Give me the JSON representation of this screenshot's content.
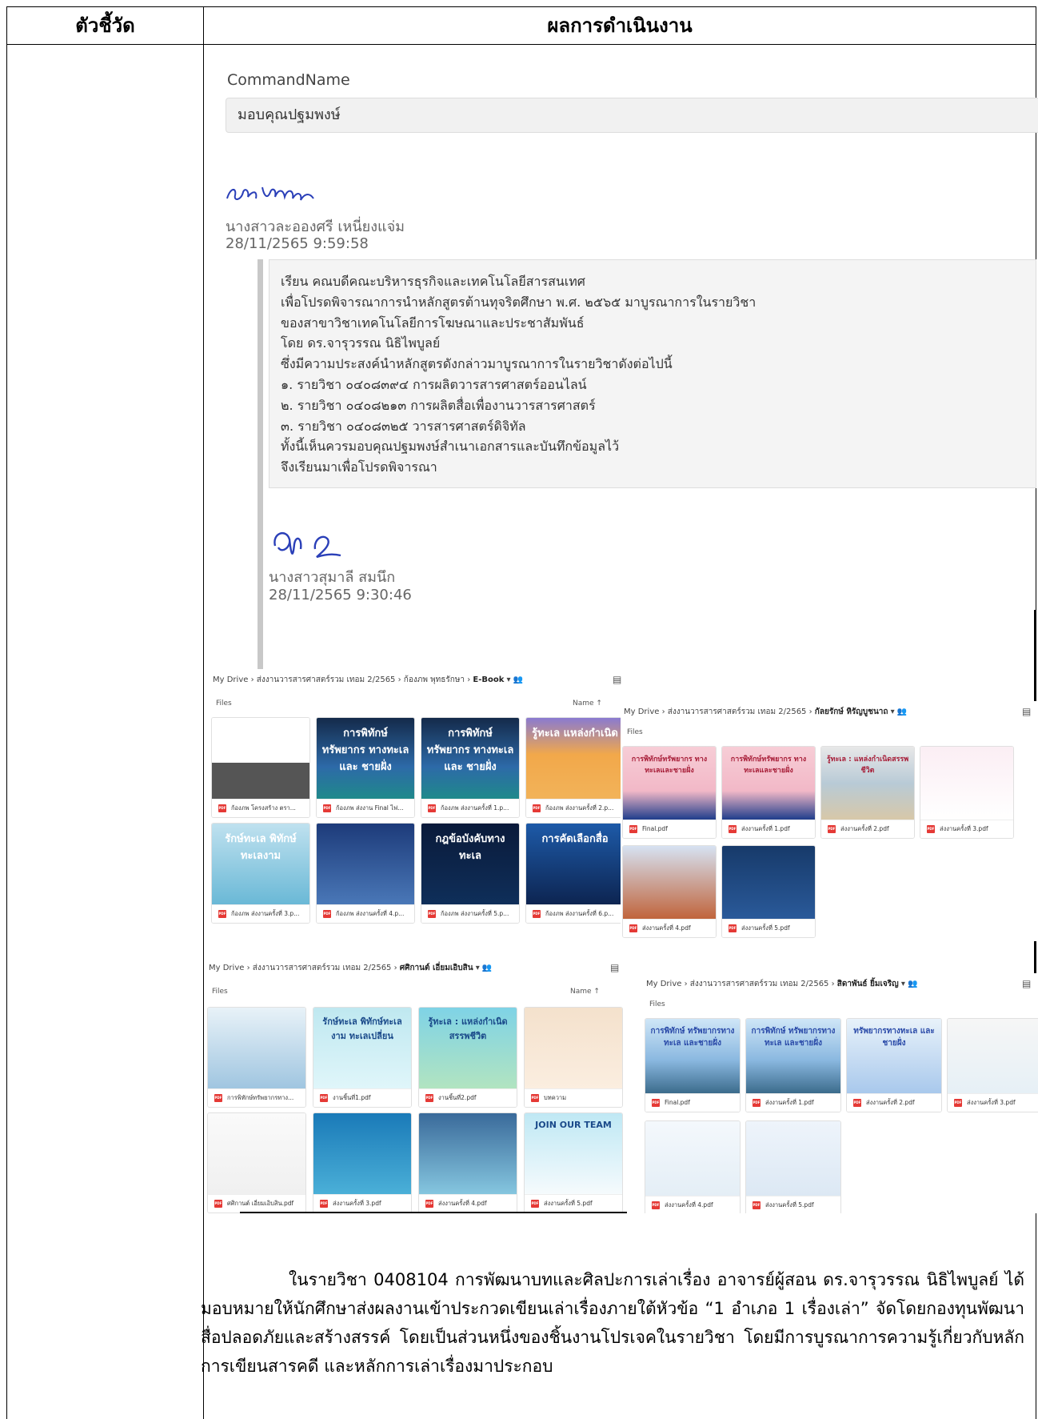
{
  "table": {
    "col1_header": "ตัวชี้วัด",
    "col2_header": "ผลการดำเนินงาน"
  },
  "edoc": {
    "command_label": "CommandName",
    "command_value": "มอบคุณปฐมพงษ์",
    "signer1_name": "นางสาวละอองศรี เหนี่ยงแจ่ม",
    "signer1_date": "28/11/2565 9:59:58",
    "memo_lines": [
      "เรียน คณบดีคณะบริหารธุรกิจและเทคโนโลยีสารสนเทศ",
      "เพื่อโปรดพิจารณาการนำหลักสูตรต้านทุจริตศึกษา พ.ศ. ๒๕๖๕ มาบูรณาการในรายวิชา",
      "ของสาขาวิชาเทคโนโลยีการโฆษณาและประชาสัมพันธ์",
      "โดย ดร.จารุวรรณ นิธิไพบูลย์",
      "ซึ่งมีความประสงค์นำหลักสูตรดังกล่าวมาบูรณาการในรายวิชาดังต่อไปนี้",
      "๑. รายวิชา ๐๔๐๘๓๙๔ การผลิตวารสารศาสตร์ออนไลน์",
      "๒. รายวิชา ๐๔๐๘๒๑๓ การผลิตสื่อเพื่องานวารสารศาสตร์",
      "๓. รายวิชา ๐๔๐๘๓๒๕ วารสารศาสตร์ดิจิทัล",
      "ทั้งนี้เห็นควรมอบคุณปฐมพงษ์สำเนาเอกสารและบันทึกข้อมูลไว้",
      "จึงเรียนมาเพื่อโปรดพิจารณา"
    ],
    "signer2_name": "นางสาวสุมาลี สมนึก",
    "signer2_date": "28/11/2565 9:30:46"
  },
  "drive": {
    "panel1": {
      "root": "My Drive",
      "folder": "ส่งงานวารสารศาสตร์รวม เทอม 2/2565",
      "sub": "ก้องภพ พุทธรักษา",
      "current": "E-Book",
      "files_label": "Files",
      "sort_label": "Name",
      "files": [
        {
          "name": "ก้องภพ โครงสร้าง ตรา...",
          "title": ""
        },
        {
          "name": "ก้องภพ ส่งงาน Final ไฟ...",
          "title": "การพิทักษ์ ทรัพยากร ทางทะเล และ ชายฝั่ง"
        },
        {
          "name": "ก้องภพ ส่งงานครั้งที่ 1.p...",
          "title": "การพิทักษ์ ทรัพยากร ทางทะเล และ ชายฝั่ง"
        },
        {
          "name": "ก้องภพ ส่งงานครั้งที่ 2.p...",
          "title": "รู้ทะเล แหล่งกำเนิด"
        },
        {
          "name": "ก้องภพ ส่งงานครั้งที่ 3.p...",
          "title": "รักษ์ทะเล พิทักษ์ทะเลงาม"
        },
        {
          "name": "ก้องภพ ส่งงานครั้งที่ 4.p...",
          "title": ""
        },
        {
          "name": "ก้องภพ ส่งงานครั้งที่ 5.p...",
          "title": "กฎข้อบังคับทางทะเล"
        },
        {
          "name": "ก้องภพ ส่งงานครั้งที่ 6.p...",
          "title": "การคัดเลือกสื่อ"
        }
      ]
    },
    "panel2": {
      "root": "My Drive",
      "folder": "ส่งงานวารสารศาสตร์รวม เทอม 2/2565",
      "current": "กัลยรักษ์ หิรัญบูชนาถ",
      "files_label": "Files",
      "files": [
        {
          "name": "Final.pdf",
          "title": "การพิทักษ์ทรัพยากร ทางทะเลและชายฝั่ง"
        },
        {
          "name": "ส่งงานครั้งที่ 1.pdf",
          "title": "การพิทักษ์ทรัพยากร ทางทะเลและชายฝั่ง"
        },
        {
          "name": "ส่งงานครั้งที่ 2.pdf",
          "title": "รู้ทะเล : แหล่งกำเนิดสรรพชีวิต"
        },
        {
          "name": "ส่งงานครั้งที่ 3.pdf",
          "title": ""
        },
        {
          "name": "ส่งงานครั้งที่ 4.pdf",
          "title": ""
        },
        {
          "name": "ส่งงานครั้งที่ 5.pdf",
          "title": ""
        }
      ]
    },
    "panel3": {
      "root": "My Drive",
      "folder": "ส่งงานวารสารศาสตร์รวม เทอม 2/2565",
      "current": "ศศิกานต์ เอี่ยมเอิบสิน",
      "files_label": "Files",
      "sort_label": "Name",
      "files": [
        {
          "name": "การพิทักษ์ทรัพยากรทาง...",
          "title": ""
        },
        {
          "name": "งานชิ้นที่1.pdf",
          "title": "รักษ์ทะเล พิทักษ์ทะเลงาม ทะเลเปลี่ยน"
        },
        {
          "name": "งานชิ้นที่2.pdf",
          "title": "รู้ทะเล : แหล่งกำเนิดสรรพชีวิต"
        },
        {
          "name": "บทความ",
          "title": ""
        },
        {
          "name": "ศศิกานต์ เอี่ยมเอิบสิน.pdf",
          "title": ""
        },
        {
          "name": "ส่งงานครั้งที่ 3.pdf",
          "title": ""
        },
        {
          "name": "ส่งงานครั้งที่ 4.pdf",
          "title": ""
        },
        {
          "name": "ส่งงานครั้งที่ 5.pdf",
          "title": "JOIN OUR TEAM"
        }
      ]
    },
    "panel4": {
      "root": "My Drive",
      "folder": "ส่งงานวารสารศาสตร์รวม เทอม 2/2565",
      "current": "สิดาพันธ์ ยิ้มเจริญ",
      "files_label": "Files",
      "files": [
        {
          "name": "Final.pdf",
          "title": "การพิทักษ์ ทรัพยากรทางทะเล และชายฝั่ง"
        },
        {
          "name": "ส่งงานครั้งที่ 1.pdf",
          "title": "การพิทักษ์ ทรัพยากรทางทะเล และชายฝั่ง"
        },
        {
          "name": "ส่งงานครั้งที่ 2.pdf",
          "title": "ทรัพยากรทางทะเล และชายฝั่ง"
        },
        {
          "name": "ส่งงานครั้งที่ 3.pdf",
          "title": ""
        },
        {
          "name": "ส่งงานครั้งที่ 4.pdf",
          "title": ""
        },
        {
          "name": "ส่งงานครั้งที่ 5.pdf",
          "title": ""
        }
      ]
    }
  },
  "body_text": "ในรายวิชา 0408104 การพัฒนาบทและศิลปะการเล่าเรื่อง อาจารย์ผู้สอน ดร.จารุวรรณ นิธิไพบูลย์ ได้มอบหมายให้นักศึกษาส่งผลงานเข้าประกวดเขียนเล่าเรื่องภายใต้หัวข้อ “1 อำเภอ 1 เรื่องเล่า” จัดโดยกองทุนพัฒนาสื่อปลอดภัยและสร้างสรรค์ โดยเป็นส่วนหนึ่งของชิ้นงานโปรเจคในรายวิชา โดยมีการบูรณาการความรู้เกี่ยวกับหลักการเขียนสารคดี และหลักการเล่าเรื่องมาประกอบ"
}
